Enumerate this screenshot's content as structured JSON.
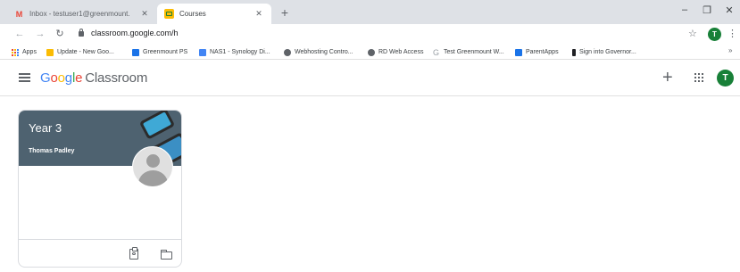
{
  "browser": {
    "tabs": [
      {
        "title": "Inbox - testuser1@greenmount.",
        "icon": "gmail-icon"
      },
      {
        "title": "Courses",
        "icon": "classroom-icon"
      }
    ],
    "new_tab": "+",
    "window_controls": {
      "minimize": "–",
      "maximize": "❐",
      "close": "✕"
    },
    "url": "classroom.google.com/h",
    "profile_initial": "T",
    "bookmarks": [
      {
        "label": "Apps",
        "icon": "apps-icon"
      },
      {
        "label": "Update - New Goo...",
        "icon": "google-icon",
        "color": "#fbbc04"
      },
      {
        "label": "Greenmount PS",
        "icon": "calendar-icon",
        "color": "#1a73e8"
      },
      {
        "label": "NAS1 - Synology Di...",
        "icon": "synology-icon",
        "color": "#4285f4"
      },
      {
        "label": "Webhosting Contro...",
        "icon": "globe-icon",
        "color": "#5f6368"
      },
      {
        "label": "RD Web Access",
        "icon": "globe-icon",
        "color": "#5f6368"
      },
      {
        "label": "Test Greenmount W...",
        "icon": "google-g-icon",
        "color": "#9aa0a6"
      },
      {
        "label": "ParentApps",
        "icon": "parentapps-icon",
        "color": "#1a73e8"
      },
      {
        "label": "Sign into Governor...",
        "icon": "governor-icon",
        "color": "#202124"
      }
    ],
    "bookmarks_overflow": "»"
  },
  "classroom": {
    "brand": {
      "g1": "G",
      "o1": "o",
      "o2": "o",
      "g2": "g",
      "l": "l",
      "e": "e",
      "product": "Classroom"
    },
    "add_button": "+",
    "user_initial": "T",
    "classes": [
      {
        "name": "Year 3",
        "teacher": "Thomas Padley"
      }
    ]
  },
  "colors": {
    "banner": "#4e6270",
    "avatar": "#188038",
    "google_blue": "#4285f4",
    "google_red": "#ea4335",
    "google_yellow": "#fbbc04",
    "google_green": "#34a853"
  }
}
